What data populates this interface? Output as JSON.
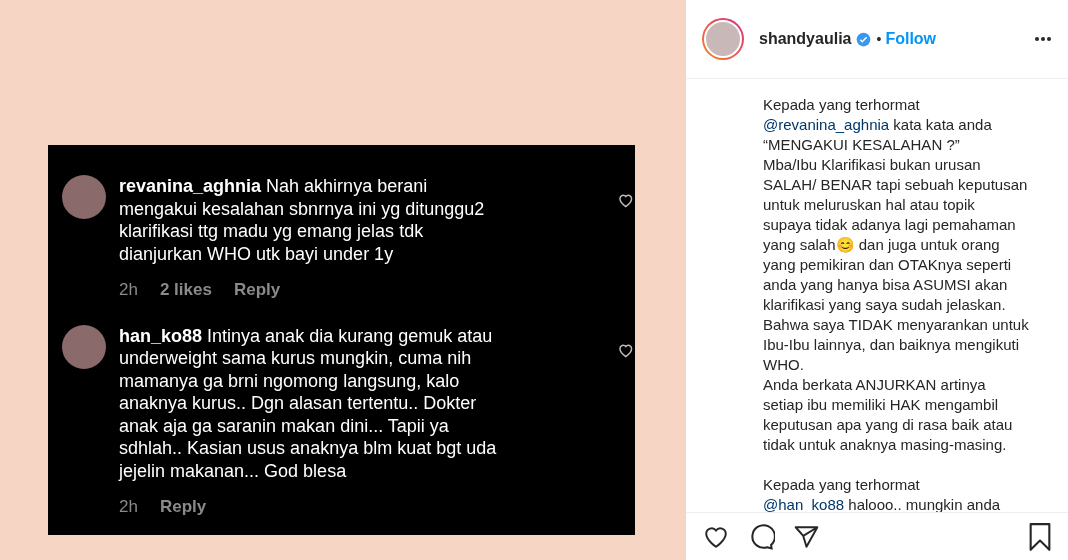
{
  "post_image": {
    "comments": [
      {
        "username": "revanina_aghnia",
        "lines": [
          "Nah akhirnya berani",
          "mengakui kesalahan sbnrnya ini yg ditunggu2",
          "klarifikasi ttg madu yg emang jelas tdk",
          "dianjurkan WHO utk bayi under 1y"
        ],
        "meta": [
          "2h",
          "2 likes",
          "Reply"
        ]
      },
      {
        "username": "han_ko88",
        "lines": [
          "Intinya anak dia kurang gemuk atau",
          "underweight sama kurus mungkin, cuma nih",
          "mamanya ga brni ngomong langsung, kalo",
          "anaknya kurus.. Dgn alasan tertentu.. Dokter",
          "anak aja ga saranin makan dini... Tapii ya",
          "sdhlah.. Kasian usus anaknya blm kuat bgt uda",
          "jejelin makanan... God blesa"
        ],
        "meta": [
          "2h",
          "Reply"
        ]
      }
    ]
  },
  "header": {
    "username": "shandyaulia",
    "verified": true,
    "separator": "•",
    "follow": "Follow"
  },
  "caption": {
    "paragraphs": [
      {
        "lines": [
          {
            "text": "Kepada yang terhormat"
          },
          {
            "mention": "@revanina_aghnia",
            "text": " kata kata anda"
          },
          {
            "text": "“MENGAKUI KESALAHAN ?”"
          },
          {
            "text": "Mba/Ibu Klarifikasi bukan urusan"
          },
          {
            "text": "SALAH/ BENAR tapi sebuah keputusan"
          },
          {
            "text": "untuk meluruskan hal atau topik"
          },
          {
            "text": "supaya tidak adanya lagi pemahaman"
          },
          {
            "text": "yang salah😊 dan juga untuk orang"
          },
          {
            "text": "yang pemikiran dan OTAKnya seperti"
          },
          {
            "text": "anda yang hanya bisa ASUMSI akan"
          },
          {
            "text": "klarifikasi yang saya sudah jelaskan."
          },
          {
            "text": "Bahwa saya TIDAK menyarankan untuk"
          },
          {
            "text": "Ibu-Ibu lainnya, dan baiknya mengikuti"
          },
          {
            "text": "WHO."
          },
          {
            "text": "Anda berkata ANJURKAN artinya"
          },
          {
            "text": "setiap ibu memiliki HAK mengambil"
          },
          {
            "text": "keputusan apa yang di rasa baik atau"
          },
          {
            "text": "tidak untuk anaknya masing-masing."
          }
        ]
      },
      {
        "lines": [
          {
            "text": "Kepada yang terhormat"
          },
          {
            "mention": "@han_ko88",
            "text": " halooo.. mungkin anda"
          }
        ]
      }
    ]
  },
  "actions": {
    "liked": false,
    "saved": false
  }
}
